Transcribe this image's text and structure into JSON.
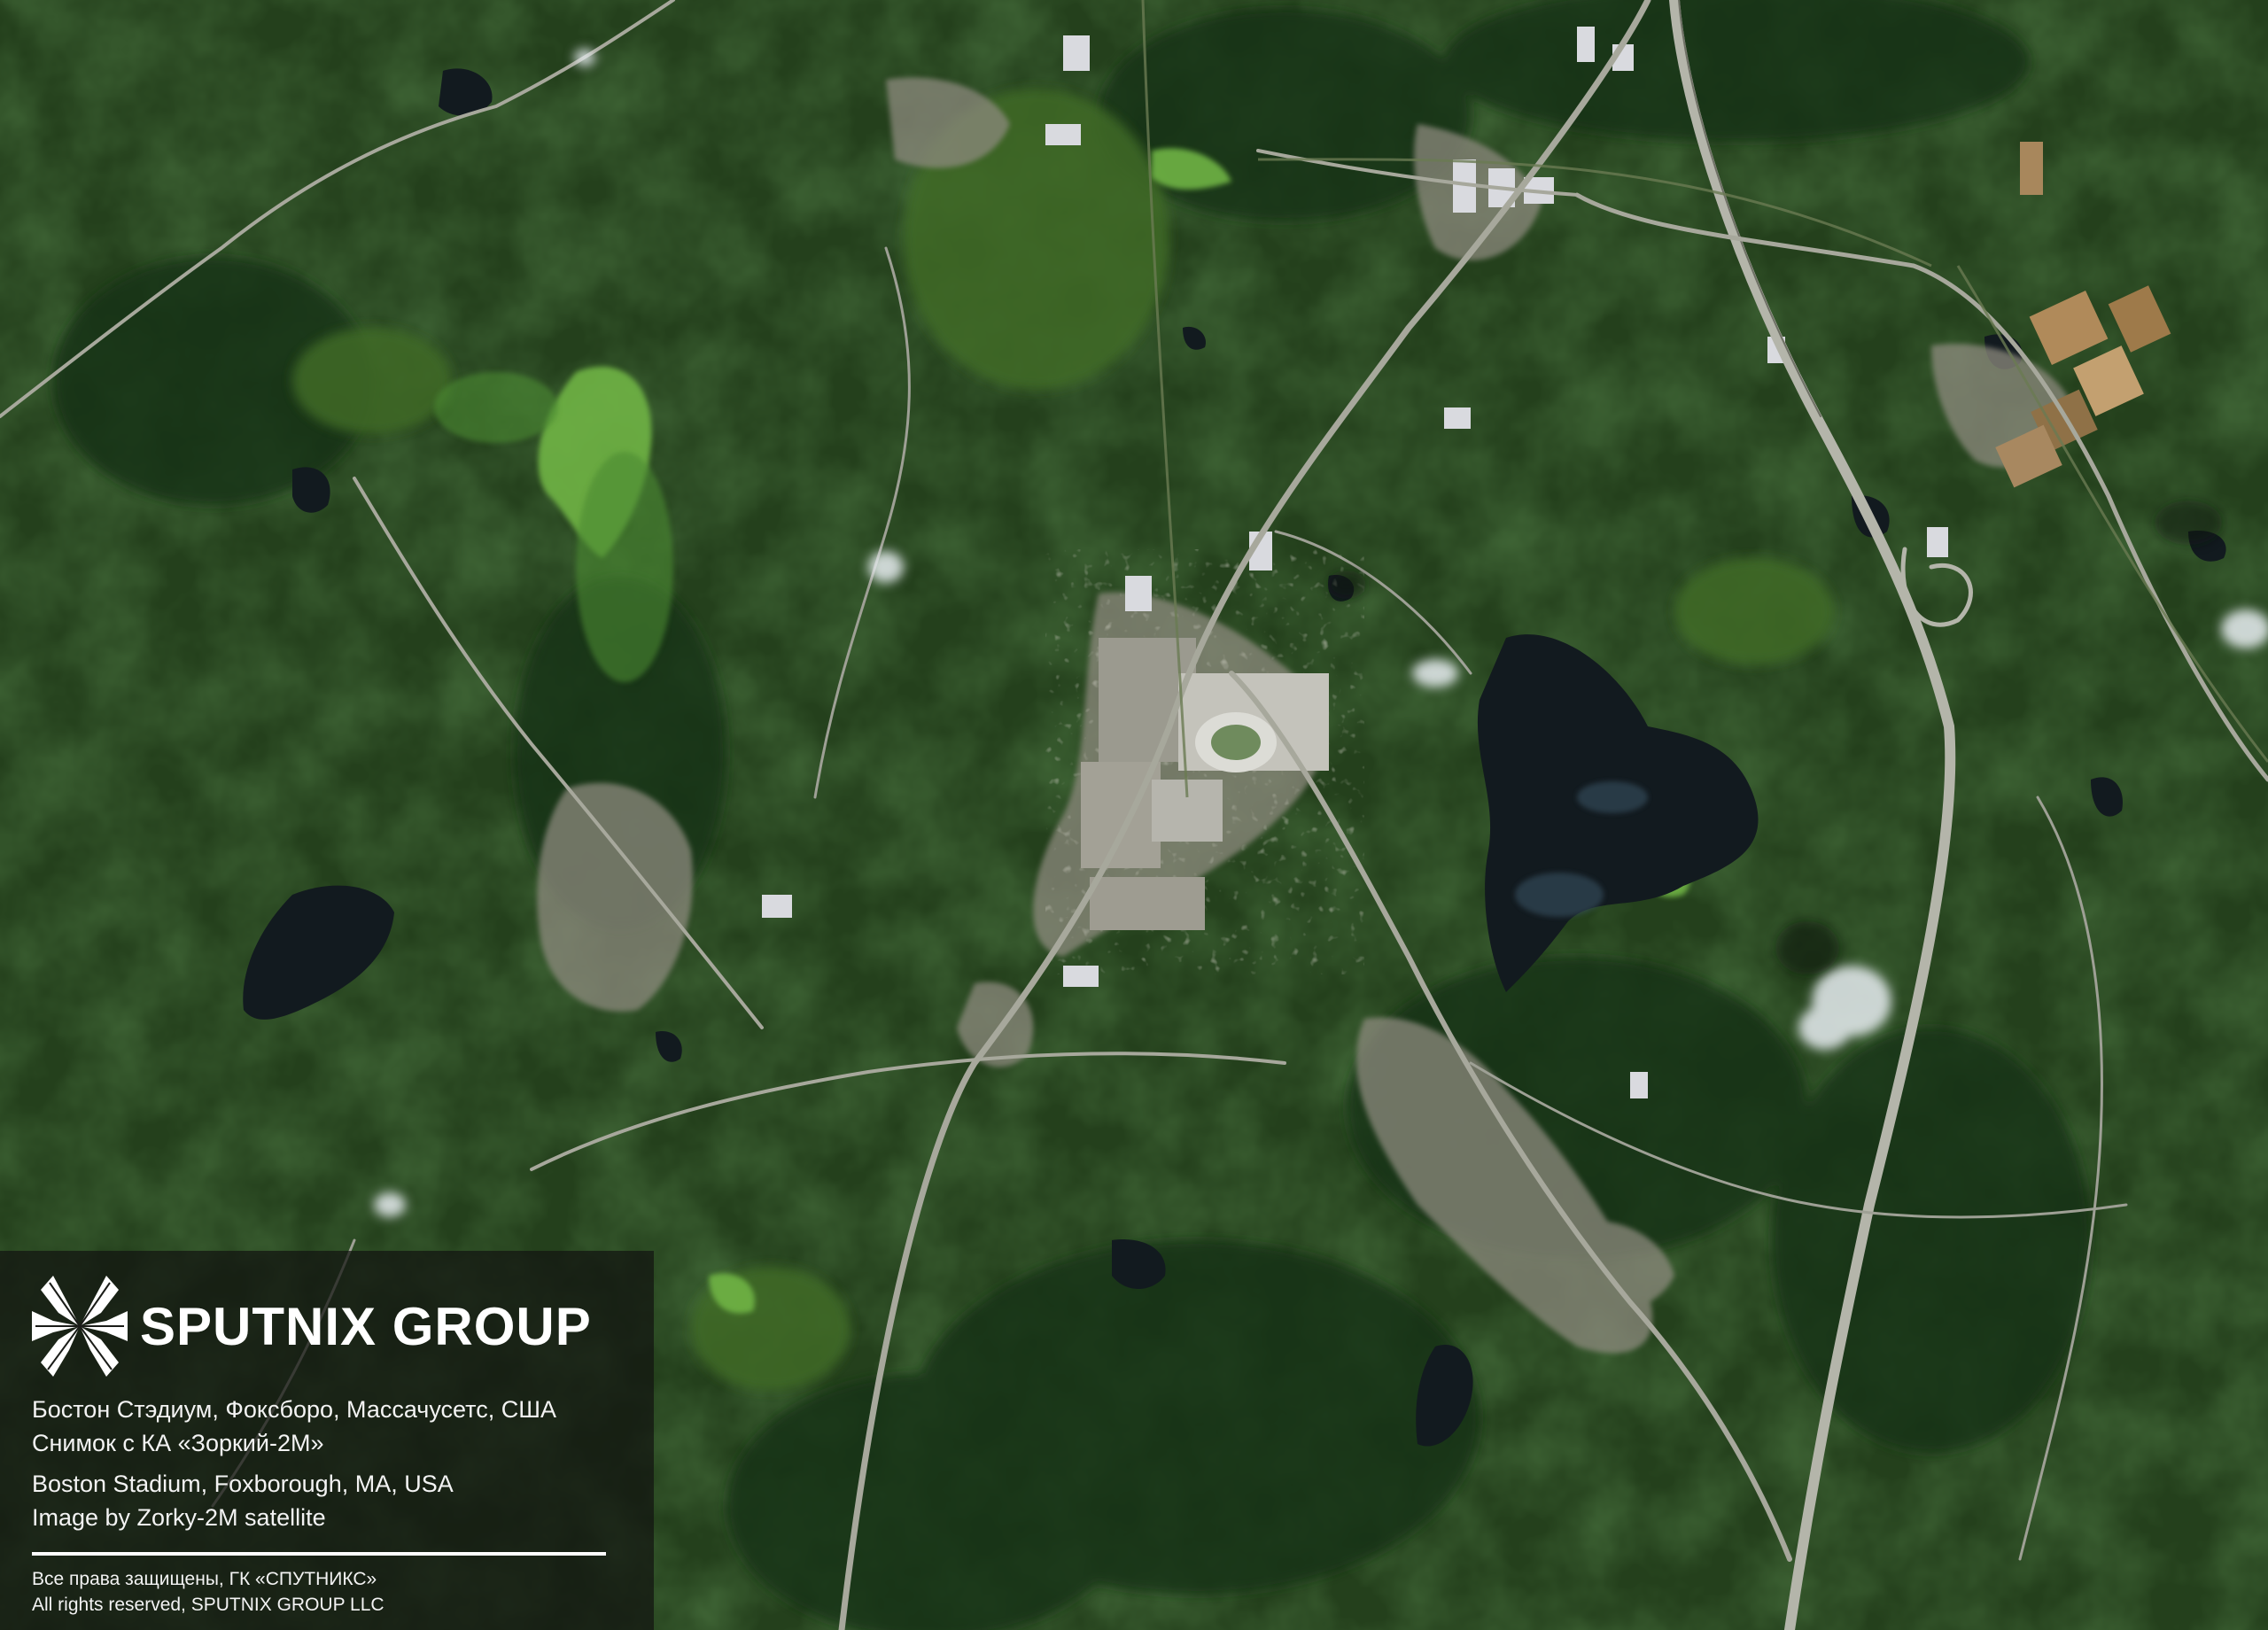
{
  "image": {
    "description_icons": [
      "satellite-scene"
    ],
    "palette": {
      "forest": "#24401c",
      "forest_dark": "#183015",
      "field": "#4e7a2e",
      "wetland": "#6fb444",
      "water": "#121a1f",
      "urban": "#8d8a7e",
      "road": "#a7a89c",
      "roof": "#d9dadf",
      "cloud": "#e8eef2",
      "panel": "#121410"
    }
  },
  "watermark": {
    "brand": "SPUTNIX GROUP",
    "logo_icon": "sputnix-star-icon",
    "caption_ru": [
      "Бостон Стэдиум, Фоксборо, Массачусетс, США",
      "Снимок с КА «Зоркий-2М»"
    ],
    "caption_en": [
      "Boston Stadium, Foxborough, MA, USA",
      "Image by Zorky-2M satellite"
    ],
    "rights": [
      "Все права защищены, ГК «СПУТНИКС»",
      "All rights reserved, SPUTNIX GROUP LLC"
    ]
  }
}
